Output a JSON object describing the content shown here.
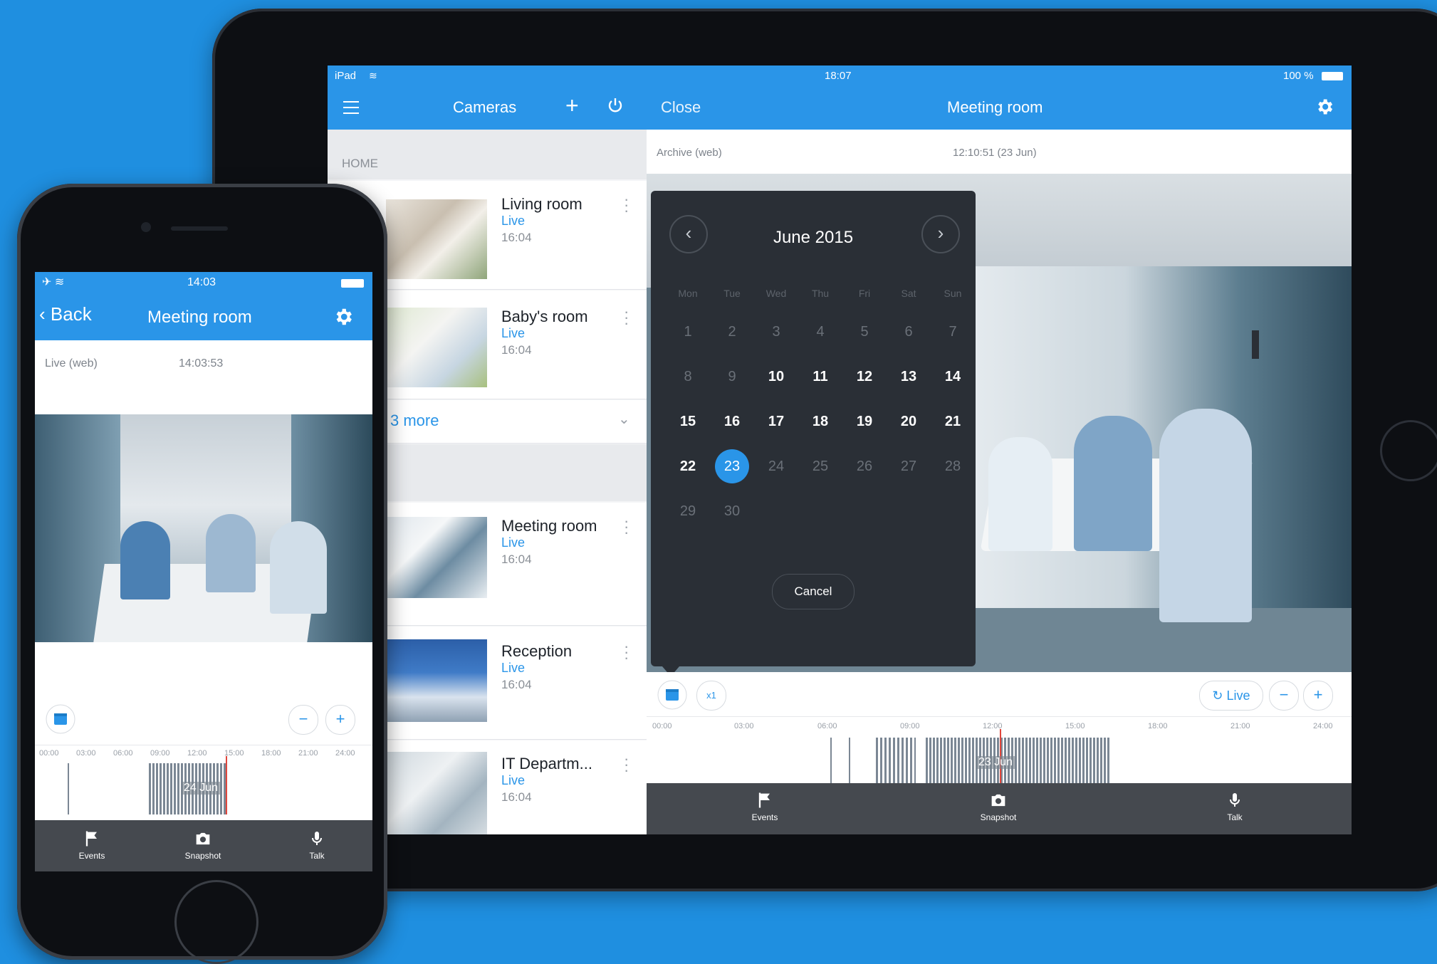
{
  "colors": {
    "background": "#1f8fe0",
    "accent": "#2a95e8",
    "calendar_bg": "#2a2f36",
    "tab_bar": "#45494f"
  },
  "ipad": {
    "status": {
      "device": "iPad",
      "time": "18:07",
      "battery": "100 %"
    },
    "left_nav": {
      "title": "Cameras",
      "menu_icon": "hamburger-icon",
      "add_icon": "plus-icon",
      "power_icon": "power-icon"
    },
    "section_home": "HOME",
    "cameras": [
      {
        "name": "Living room",
        "status": "Live",
        "time": "16:04"
      },
      {
        "name": "Baby's room",
        "status": "Live",
        "time": "16:04"
      }
    ],
    "more_label": "3 more",
    "cameras2": [
      {
        "name": "Meeting room",
        "status": "Live",
        "time": "16:04"
      },
      {
        "name": "Reception",
        "status": "Live",
        "time": "16:04"
      },
      {
        "name": "IT Departm...",
        "status": "Live",
        "time": "16:04"
      }
    ],
    "right_nav": {
      "close": "Close",
      "title": "Meeting room",
      "settings_icon": "gear-icon"
    },
    "info": {
      "mode": "Archive (web)",
      "timestamp": "12:10:51 (23 Jun)"
    },
    "calendar": {
      "month": "June 2015",
      "weekdays": [
        "Mon",
        "Tue",
        "Wed",
        "Thu",
        "Fri",
        "Sat",
        "Sun"
      ],
      "weeks": [
        [
          "1",
          "2",
          "3",
          "4",
          "5",
          "6",
          "7"
        ],
        [
          "8",
          "9",
          "10",
          "11",
          "12",
          "13",
          "14"
        ],
        [
          "15",
          "16",
          "17",
          "18",
          "19",
          "20",
          "21"
        ],
        [
          "22",
          "23",
          "24",
          "25",
          "26",
          "27",
          "28"
        ],
        [
          "29",
          "30",
          "",
          "",
          "",
          "",
          ""
        ]
      ],
      "selected": "23",
      "cancel": "Cancel"
    },
    "controls": {
      "speed": "x1",
      "live": "Live",
      "minus": "−",
      "plus": "+"
    },
    "timeline": {
      "ticks": [
        "00:00",
        "03:00",
        "06:00",
        "09:00",
        "12:00",
        "15:00",
        "18:00",
        "21:00",
        "24:00"
      ],
      "date_label": "23 Jun"
    },
    "tabs": [
      {
        "label": "Events",
        "icon": "flag-icon"
      },
      {
        "label": "Snapshot",
        "icon": "camera-icon"
      },
      {
        "label": "Talk",
        "icon": "microphone-icon"
      }
    ]
  },
  "iphone": {
    "status": {
      "time": "14:03"
    },
    "nav": {
      "back": "Back",
      "title": "Meeting room"
    },
    "info": {
      "mode": "Live (web)",
      "timestamp": "14:03:53"
    },
    "controls": {
      "minus": "−",
      "plus": "+"
    },
    "timeline": {
      "ticks": [
        "00:00",
        "03:00",
        "06:00",
        "09:00",
        "12:00",
        "15:00",
        "18:00",
        "21:00",
        "24:00"
      ],
      "date_label": "24 Jun"
    },
    "tabs": [
      {
        "label": "Events",
        "icon": "flag-icon"
      },
      {
        "label": "Snapshot",
        "icon": "camera-icon"
      },
      {
        "label": "Talk",
        "icon": "microphone-icon"
      }
    ]
  }
}
